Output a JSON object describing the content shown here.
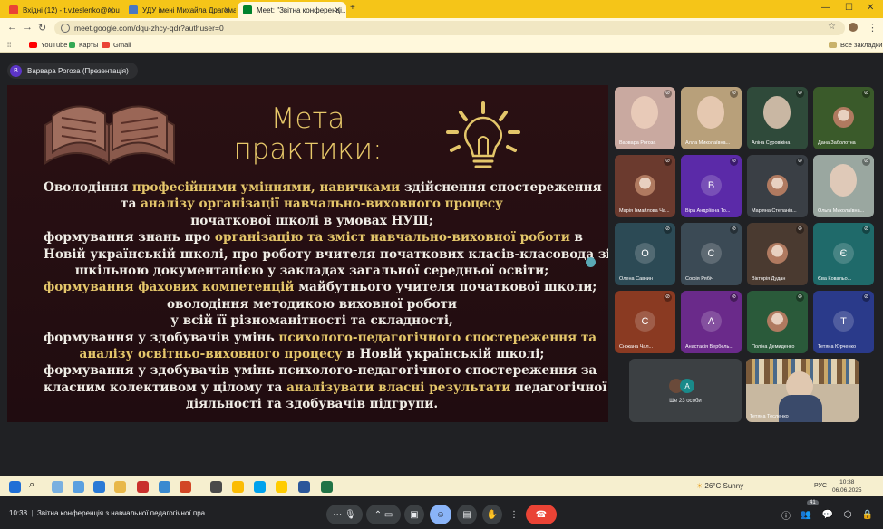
{
  "browser": {
    "tabs": [
      {
        "label": "Вхідні (12) - t.v.teslenko@npu.ed",
        "active": false
      },
      {
        "label": "УДУ імені Михайла Драгоманова",
        "active": false
      },
      {
        "label": "Meet: \"Звітна конференці...",
        "active": true
      }
    ],
    "new_tab": "+",
    "url": "meet.google.com/dqu-zhcy-qdr?authuser=0",
    "bookmarks": [
      "YouTube",
      "Карты",
      "Gmail"
    ],
    "all_bookmarks": "Все закладки"
  },
  "meet": {
    "presenter_chip": {
      "initial": "B",
      "text": "Варвара Рогоза (Презентація)"
    },
    "slide": {
      "title_line1": "Мета",
      "title_line2": "практики:",
      "lines": [
        [
          {
            "t": "Оволодіння "
          },
          {
            "t": "професійними уміннями, навичками",
            "hl": true
          },
          {
            "t": " здійснення спостереження"
          }
        ],
        [
          {
            "t": "та "
          },
          {
            "t": "аналізу організації навчально-виховного процесу",
            "hl": true
          }
        ],
        [
          {
            "t": "початкової школі в умовах НУШ;"
          }
        ],
        [
          {
            "t": "формування знань про "
          },
          {
            "t": "організацію та зміст навчально-виховної роботи",
            "hl": true
          },
          {
            "t": " в"
          }
        ],
        [
          {
            "t": "Новій українській школі, про роботу вчителя початкових класів-класовода зі"
          }
        ],
        [
          {
            "t": "шкільною документацією у закладах загальної середньої освіти;"
          }
        ],
        [
          {
            "t": "формування фахових компетенцій",
            "hl": true
          },
          {
            "t": " майбутнього учителя початкової школи;"
          }
        ],
        [
          {
            "t": "оволодіння методикою виховної роботи"
          }
        ],
        [
          {
            "t": "у всій її різноманітності та складності,"
          }
        ],
        [
          {
            "t": "формування у здобувачів умінь "
          },
          {
            "t": "психолого-педагогічного спостереження та",
            "hl": true
          }
        ],
        [
          {
            "t": "аналізу освітньо-виховного процесу",
            "hl": true
          },
          {
            "t": " в Новій українській школі;"
          }
        ],
        [
          {
            "t": "формування у здобувачів умінь психолого-педагогічного спостереження за"
          }
        ],
        [
          {
            "t": "класним колективом у цілому та "
          },
          {
            "t": "аналізувати власні результати",
            "hl": true
          },
          {
            "t": " педагогічної"
          }
        ],
        [
          {
            "t": "діяльності та здобувачів підгрупи."
          }
        ]
      ]
    },
    "participants": [
      {
        "name": "Варвара Рогоза",
        "kind": "photo",
        "color": "#c9a9a0"
      },
      {
        "name": "Алла Миколаївна...",
        "kind": "photo",
        "color": "#b8a07a"
      },
      {
        "name": "Аліна Суровікіна",
        "kind": "photo",
        "color": "#2f4a3a"
      },
      {
        "name": "Дана Заболотна",
        "kind": "avatar-img",
        "color": "#3a5a2a"
      },
      {
        "name": "Марія Ізмайлова Ча...",
        "kind": "avatar-img",
        "color": "#6b3a2e"
      },
      {
        "name": "Віра Андріївна То...",
        "kind": "letter",
        "letter": "В",
        "color": "#5b2aa8"
      },
      {
        "name": "Мар'яна Степанів...",
        "kind": "avatar-img",
        "color": "#3a3f45"
      },
      {
        "name": "Ольга Миколаївна...",
        "kind": "photo",
        "color": "#9aa7a0"
      },
      {
        "name": "Олена Савчин",
        "kind": "letter",
        "letter": "О",
        "color": "#2c4a55"
      },
      {
        "name": "Софія Рябіч",
        "kind": "letter",
        "letter": "С",
        "color": "#3b4a55"
      },
      {
        "name": "Вікторія Дудан",
        "kind": "avatar-img",
        "color": "#4a3a30"
      },
      {
        "name": "Єва Ковальо...",
        "kind": "letter",
        "letter": "Є",
        "color": "#1f6a6a"
      },
      {
        "name": "Сніжана Чал...",
        "kind": "letter",
        "letter": "С",
        "color": "#8a3a22"
      },
      {
        "name": "Анастасія Вербель...",
        "kind": "letter",
        "letter": "А",
        "color": "#6a2a8a"
      },
      {
        "name": "Поліна Демиденко",
        "kind": "avatar-img",
        "color": "#2a5a3a"
      },
      {
        "name": "Тетяна Юрченко",
        "kind": "letter",
        "letter": "Т",
        "color": "#2a3a8a"
      }
    ],
    "more_tile": {
      "text": "Ще 23 особи",
      "letter": "A"
    },
    "self_tile": {
      "name": "Тетяна Тесленко"
    },
    "meeting_time": "10:38",
    "meeting_title": "Звітна конференція з навчальної педагогічної пра...",
    "participant_count": "41",
    "reactions": [
      "💖",
      "👍",
      "🎉",
      "👏",
      "😂",
      "😮",
      "😢",
      "🤔",
      "👎"
    ]
  },
  "taskbar": {
    "weather": "26°C  Sunny",
    "lang": "РУС",
    "time": "10:38",
    "date": "06.06.2025"
  }
}
